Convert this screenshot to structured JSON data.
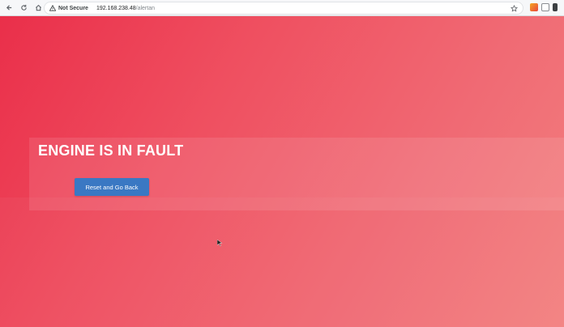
{
  "browser": {
    "not_secure_label": "Not Secure",
    "url_host": "192.168.238.48",
    "url_path": "/alertan"
  },
  "page": {
    "title": "ENGINE IS IN FAULT",
    "reset_button_label": "Reset and Go Back"
  },
  "colors": {
    "background_start": "#ea2f4a",
    "background_end": "#f3807f",
    "button": "#3a78c3",
    "title_text": "#ffffff"
  },
  "icons": {
    "back": "back-arrow-icon",
    "reload": "reload-icon",
    "home": "home-icon",
    "not_secure": "warning-triangle-icon",
    "bookmark": "star-icon"
  }
}
